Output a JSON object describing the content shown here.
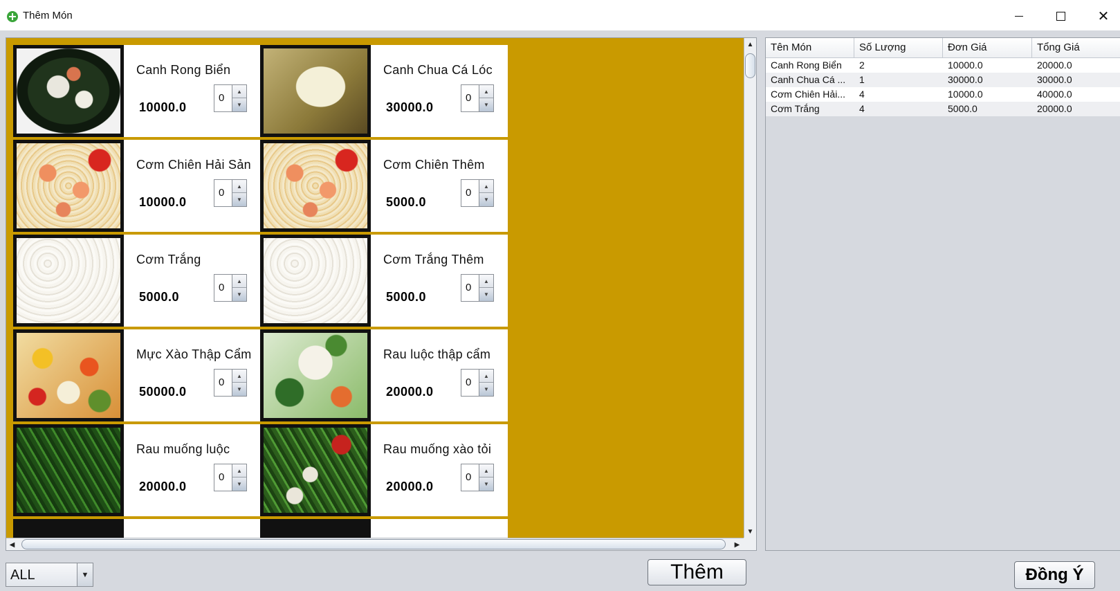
{
  "window": {
    "title": "Thêm Món"
  },
  "menu_items": [
    {
      "name": "Canh Rong Biển",
      "price": "10000.0",
      "qty": "0",
      "image": "seaweed-soup"
    },
    {
      "name": "Canh Chua Cá Lóc",
      "price": "30000.0",
      "qty": "0",
      "image": "sour-fish-soup"
    },
    {
      "name": "Cơm Chiên Hải Sản",
      "price": "10000.0",
      "qty": "0",
      "image": "seafood-fried-rice"
    },
    {
      "name": "Cơm Chiên Thêm",
      "price": "5000.0",
      "qty": "0",
      "image": "fried-rice"
    },
    {
      "name": "Cơm Trắng",
      "price": "5000.0",
      "qty": "0",
      "image": "white-rice"
    },
    {
      "name": "Cơm Trắng Thêm",
      "price": "5000.0",
      "qty": "0",
      "image": "white-rice"
    },
    {
      "name": "Mực Xào Thập Cẩm",
      "price": "50000.0",
      "qty": "0",
      "image": "stir-fried-squid"
    },
    {
      "name": "Rau luộc thập cẩm",
      "price": "20000.0",
      "qty": "0",
      "image": "boiled-vegetables"
    },
    {
      "name": "Rau muống luộc",
      "price": "20000.0",
      "qty": "0",
      "image": "boiled-morning-glory"
    },
    {
      "name": "Rau muống xào tỏi",
      "price": "20000.0",
      "qty": "0",
      "image": "garlic-morning-glory"
    }
  ],
  "order_table": {
    "columns": [
      "Tên Món",
      "Số Lượng",
      "Đơn Giá",
      "Tổng Giá"
    ],
    "rows": [
      [
        "Canh Rong Biển",
        "2",
        "10000.0",
        "20000.0"
      ],
      [
        "Canh Chua Cá ...",
        "1",
        "30000.0",
        "30000.0"
      ],
      [
        "Cơm Chiên Hải...",
        "4",
        "10000.0",
        "40000.0"
      ],
      [
        "Cơm Trắng",
        "4",
        "5000.0",
        "20000.0"
      ]
    ]
  },
  "filter": {
    "selected": "ALL"
  },
  "buttons": {
    "add": "Thêm",
    "confirm": "Đồng Ý"
  },
  "colors": {
    "grid_background": "#c99a00",
    "accent_icon": "#3aa53a"
  }
}
